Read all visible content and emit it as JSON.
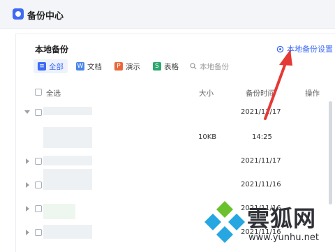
{
  "app": {
    "title": "备份中心"
  },
  "section": {
    "title": "本地备份",
    "settings_label": "本地备份设置"
  },
  "filters": [
    {
      "label": "全部",
      "icon": "list-icon",
      "color": "#3d6bf5",
      "glyph": "≡",
      "active": true
    },
    {
      "label": "文档",
      "icon": "doc-icon",
      "color": "#4a86e8",
      "glyph": "W",
      "active": false
    },
    {
      "label": "演示",
      "icon": "ppt-icon",
      "color": "#e8683c",
      "glyph": "P",
      "active": false
    },
    {
      "label": "表格",
      "icon": "sheet-icon",
      "color": "#2aa86a",
      "glyph": "S",
      "active": false
    }
  ],
  "search": {
    "placeholder": "本地备份"
  },
  "table": {
    "select_all": "全选",
    "columns": {
      "size": "大小",
      "time": "备份时间",
      "action": "操作"
    },
    "rows": [
      {
        "size": "",
        "time": "2021/11/17",
        "expanded": true
      },
      {
        "size": "10KB",
        "time": "14:25",
        "child": true
      },
      {
        "size": "",
        "time": "2021/11/17",
        "expanded": false
      },
      {
        "size": "",
        "time": "2021/11/16",
        "expanded": false
      },
      {
        "size": "",
        "time": "2021/11/16",
        "expanded": false
      },
      {
        "size": "",
        "time": "2021/11/16",
        "expanded": false
      }
    ]
  },
  "watermark": {
    "text": "雲狐网",
    "url": "www.yunhu.net"
  },
  "colors": {
    "accent": "#3d6bf5",
    "arrow": "#e53935"
  }
}
